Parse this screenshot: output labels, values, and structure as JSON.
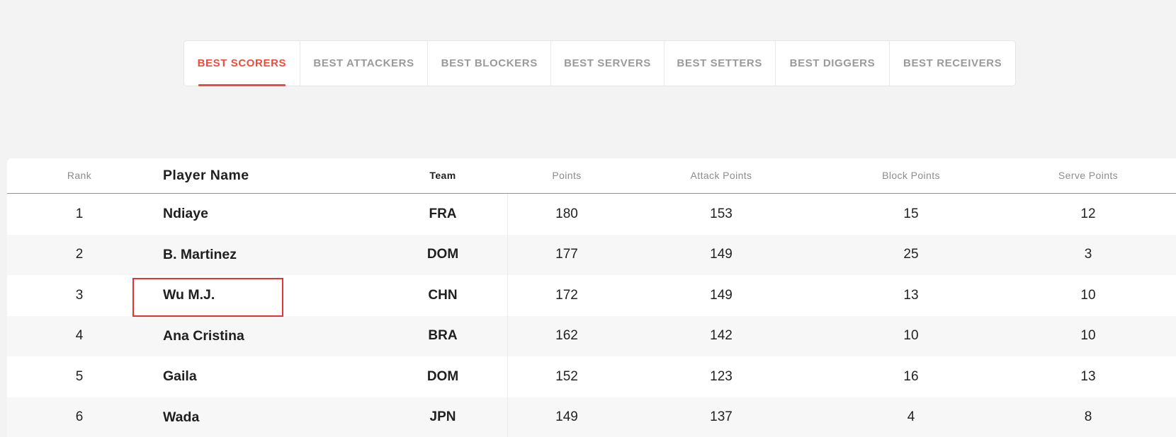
{
  "tabs": [
    {
      "label": "BEST SCORERS",
      "active": true
    },
    {
      "label": "BEST ATTACKERS",
      "active": false
    },
    {
      "label": "BEST BLOCKERS",
      "active": false
    },
    {
      "label": "BEST SERVERS",
      "active": false
    },
    {
      "label": "BEST SETTERS",
      "active": false
    },
    {
      "label": "BEST DIGGERS",
      "active": false
    },
    {
      "label": "BEST RECEIVERS",
      "active": false
    }
  ],
  "colors": {
    "accent": "#ee4b3b",
    "highlight_box": "#e03535",
    "page_bg": "#f3f3f3"
  },
  "table": {
    "headers": {
      "rank": "Rank",
      "player": "Player Name",
      "team": "Team",
      "points": "Points",
      "attack": "Attack Points",
      "block": "Block Points",
      "serve": "Serve Points"
    },
    "rows": [
      {
        "rank": "1",
        "player": "Ndiaye",
        "team": "FRA",
        "points": "180",
        "attack": "153",
        "block": "15",
        "serve": "12"
      },
      {
        "rank": "2",
        "player": "B. Martinez",
        "team": "DOM",
        "points": "177",
        "attack": "149",
        "block": "25",
        "serve": "3"
      },
      {
        "rank": "3",
        "player": "Wu M.J.",
        "team": "CHN",
        "points": "172",
        "attack": "149",
        "block": "13",
        "serve": "10"
      },
      {
        "rank": "4",
        "player": "Ana Cristina",
        "team": "BRA",
        "points": "162",
        "attack": "142",
        "block": "10",
        "serve": "10"
      },
      {
        "rank": "5",
        "player": "Gaila",
        "team": "DOM",
        "points": "152",
        "attack": "123",
        "block": "16",
        "serve": "13"
      },
      {
        "rank": "6",
        "player": "Wada",
        "team": "JPN",
        "points": "149",
        "attack": "137",
        "block": "4",
        "serve": "8"
      }
    ]
  }
}
